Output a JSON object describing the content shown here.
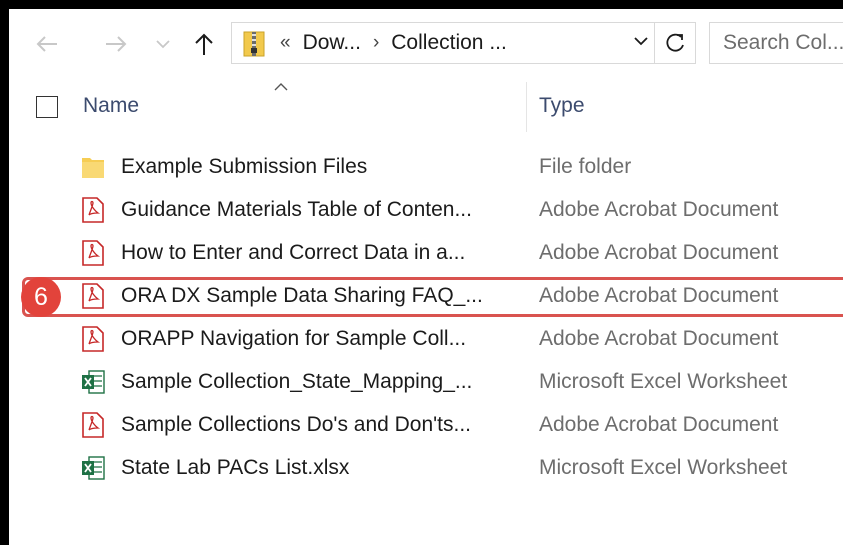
{
  "nav": {
    "address_prefix": "«",
    "breadcrumb": [
      "Dow...",
      "Collection ..."
    ],
    "search_placeholder": "Search Col..."
  },
  "header": {
    "name_col": "Name",
    "type_col": "Type"
  },
  "files": [
    {
      "name": "Example Submission Files",
      "type": "File folder",
      "icon": "folder-icon"
    },
    {
      "name": "Guidance Materials Table of Conten...",
      "type": "Adobe Acrobat Document",
      "icon": "pdf-icon"
    },
    {
      "name": "How to Enter and Correct Data in a...",
      "type": "Adobe Acrobat Document",
      "icon": "pdf-icon"
    },
    {
      "name": "ORA DX Sample Data Sharing FAQ_...",
      "type": "Adobe Acrobat Document",
      "icon": "pdf-icon"
    },
    {
      "name": "ORAPP Navigation for Sample Coll...",
      "type": "Adobe Acrobat Document",
      "icon": "pdf-icon"
    },
    {
      "name": "Sample Collection_State_Mapping_...",
      "type": "Microsoft Excel Worksheet",
      "icon": "excel-icon"
    },
    {
      "name": "Sample Collections Do's and Don'ts...",
      "type": "Adobe Acrobat Document",
      "icon": "pdf-icon"
    },
    {
      "name": "State Lab PACs List.xlsx",
      "type": "Microsoft Excel Worksheet",
      "icon": "excel-icon"
    }
  ],
  "annotation": {
    "step_number": "6",
    "highlight_color": "#d9534f",
    "badge_color": "#e2433b"
  }
}
